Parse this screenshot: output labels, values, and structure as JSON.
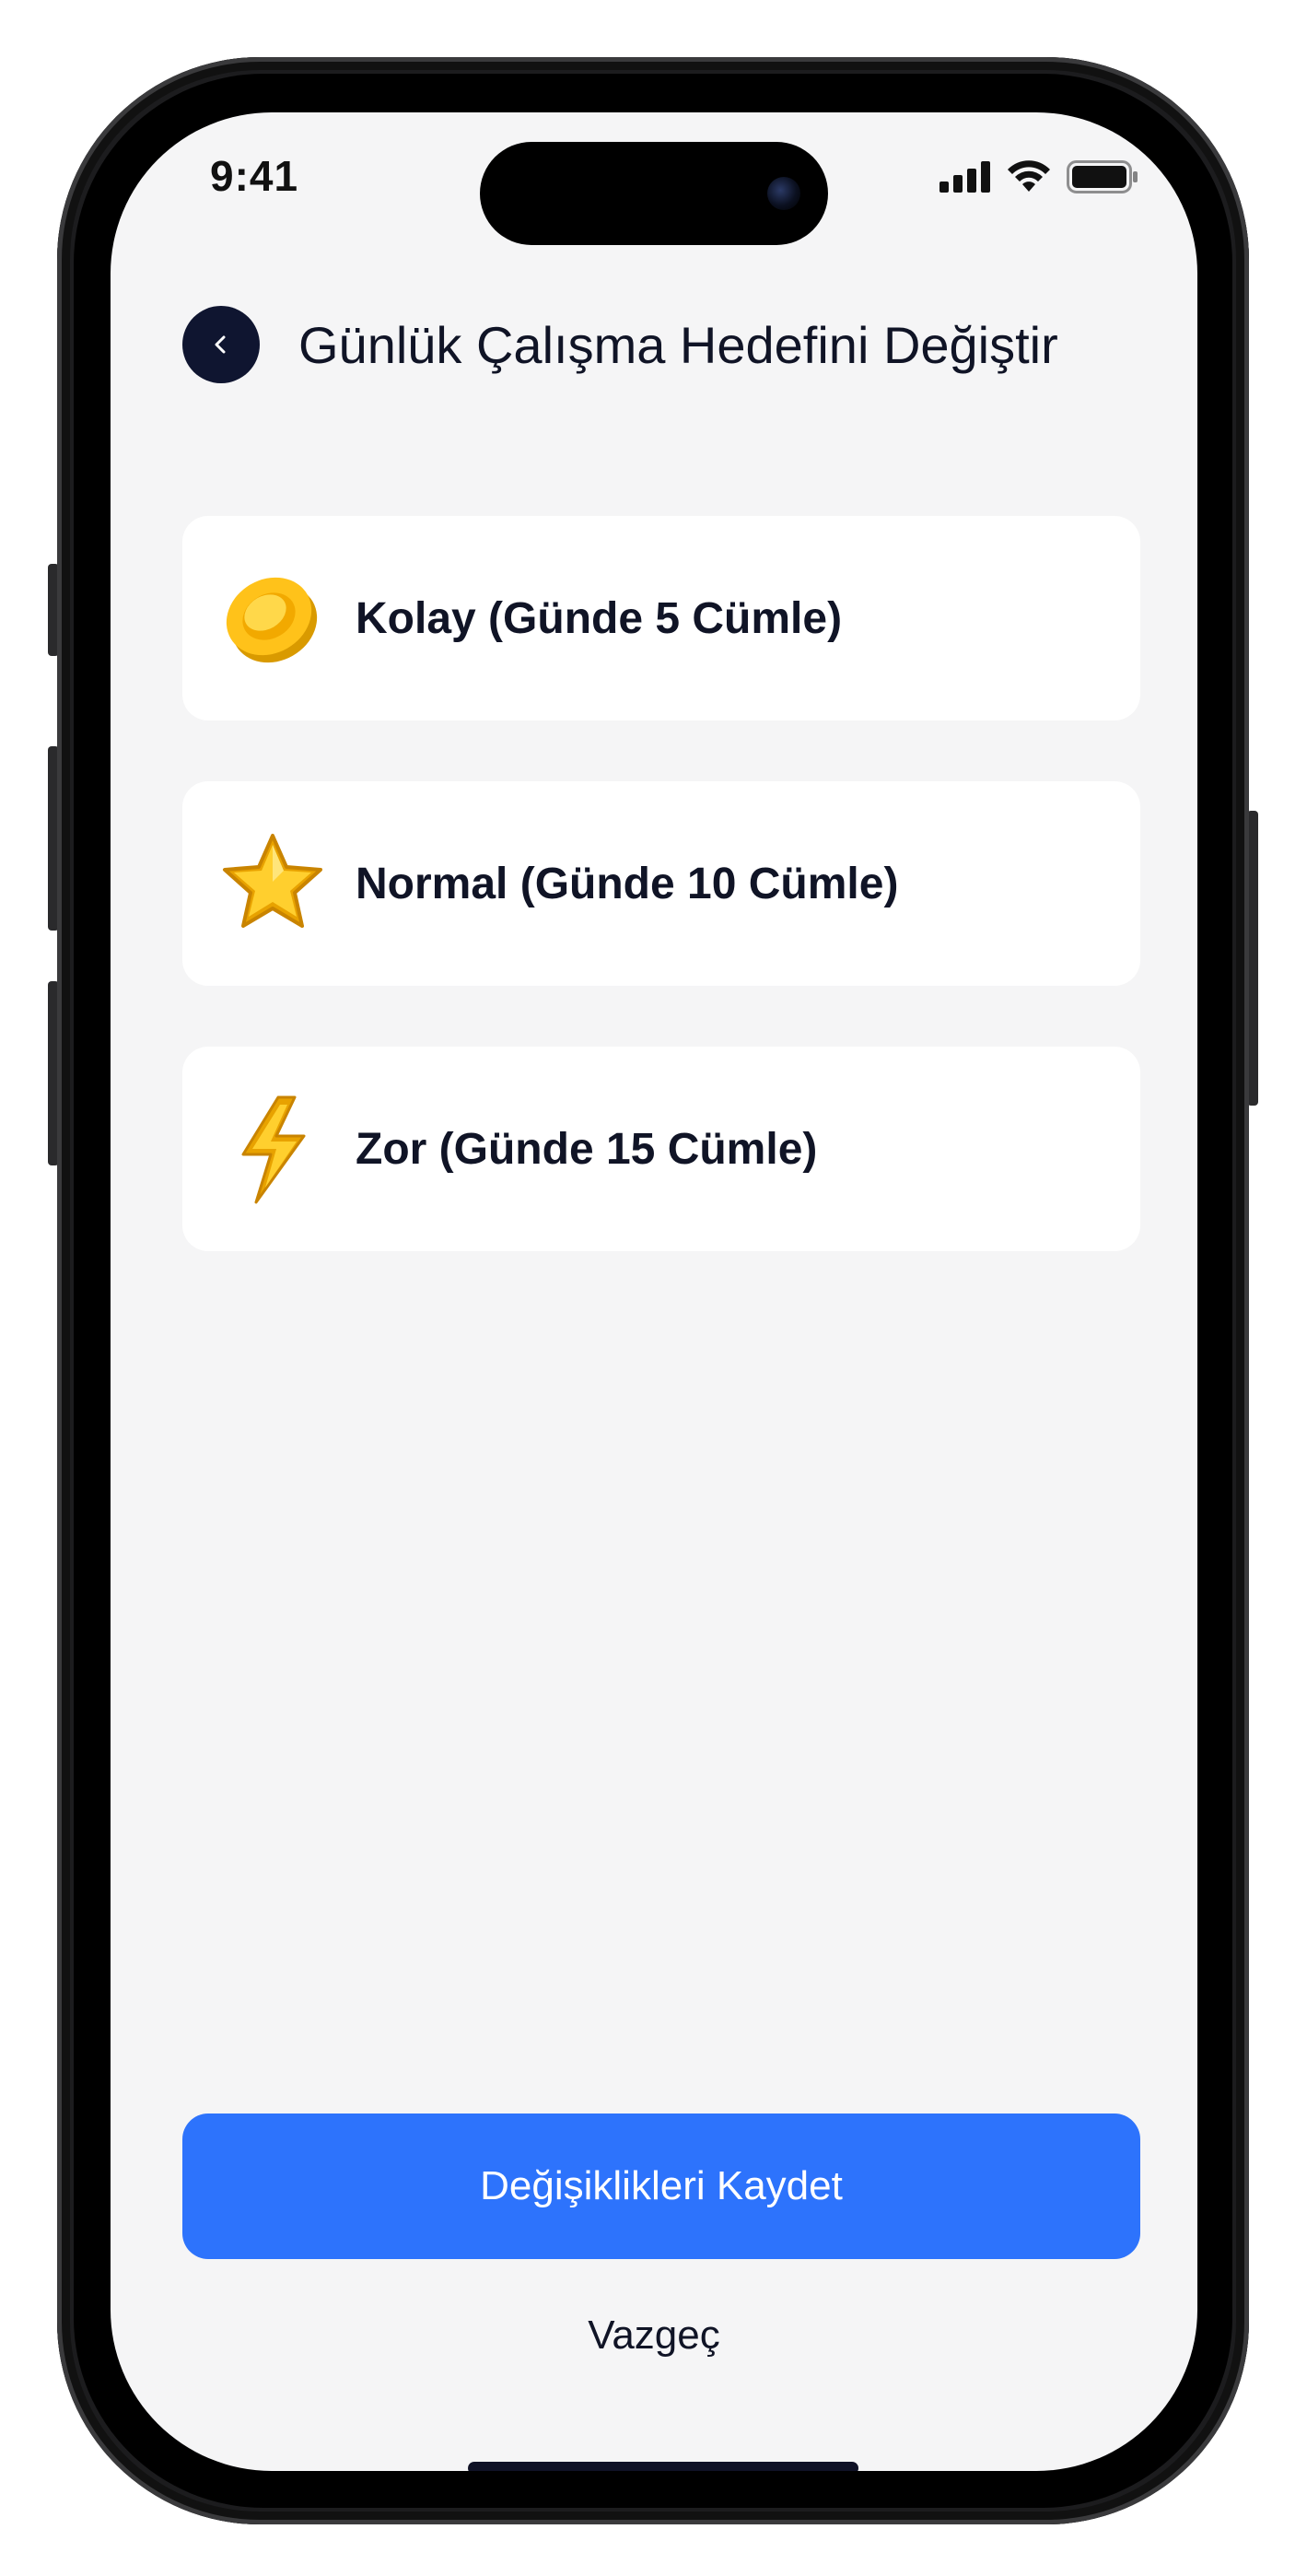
{
  "status_bar": {
    "time": "9:41"
  },
  "header": {
    "title": "Günlük Çalışma Hedefini Değiştir"
  },
  "options": [
    {
      "label": "Kolay (Günde 5 Cümle)",
      "icon": "coin-icon"
    },
    {
      "label": "Normal (Günde 10 Cümle)",
      "icon": "star-icon"
    },
    {
      "label": "Zor (Günde 15 Cümle)",
      "icon": "lightning-icon"
    }
  ],
  "actions": {
    "save_label": "Değişiklikleri Kaydet",
    "cancel_label": "Vazgeç"
  },
  "colors": {
    "primary": "#2d73fc",
    "dark": "#0f1530",
    "background": "#f5f5f6"
  }
}
